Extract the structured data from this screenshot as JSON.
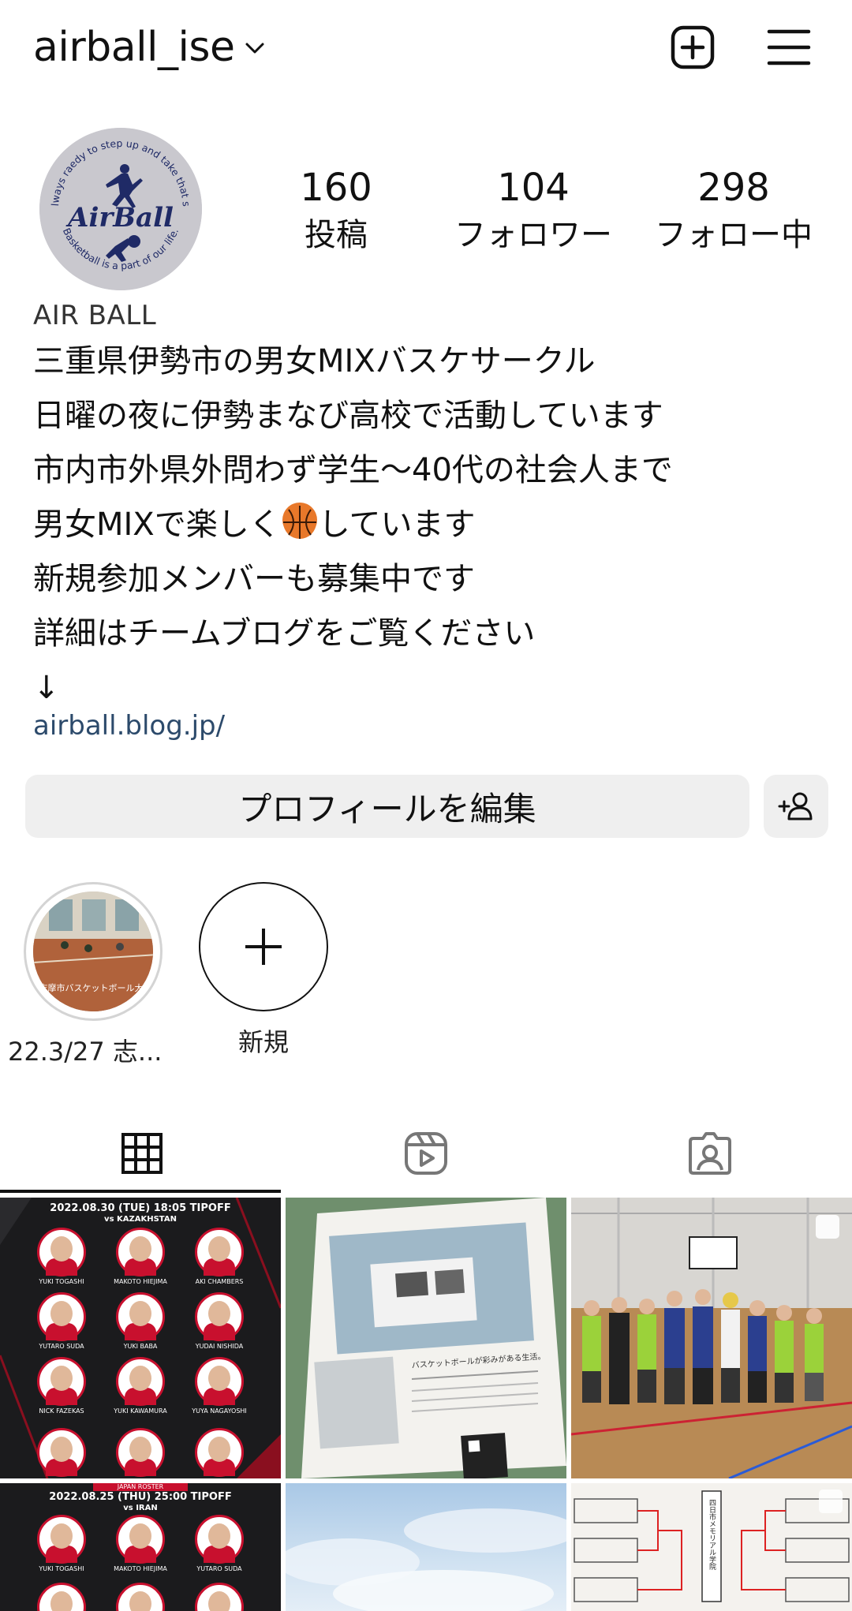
{
  "header": {
    "username": "airball_ise"
  },
  "profile": {
    "avatar_text_top": "I'm always raedy to step up and take that shot!!",
    "avatar_text_bottom": "Basketball is a part of our life.",
    "avatar_brand": "AirBall",
    "stats": {
      "posts_count": "160",
      "posts_label": "投稿",
      "followers_count": "104",
      "followers_label": "フォロワー",
      "following_count": "298",
      "following_label": "フォロー中"
    },
    "display_name": "AIR BALL",
    "bio_lines": [
      "三重県伊勢市の男女MIXバスケサークル",
      "日曜の夜に伊勢まなび高校で活動しています",
      "市内市外県外問わず学生〜40代の社会人まで",
      "男女MIXで楽しく",
      "新規参加メンバーも募集中です",
      "詳細はチームブログをご覧ください",
      "↓"
    ],
    "bio_line4_suffix": "しています",
    "link": "airball.blog.jp/"
  },
  "actions": {
    "edit_profile_label": "プロフィールを編集"
  },
  "highlights": [
    {
      "label": "22.3/27 志...",
      "caption": "志摩市バスケットボール大会"
    },
    {
      "label": "新規"
    }
  ],
  "tabs": [
    {
      "name": "grid",
      "active": true
    },
    {
      "name": "reels",
      "active": false
    },
    {
      "name": "tagged",
      "active": false
    }
  ],
  "posts": {
    "roster1": {
      "title": "2022.08.30 (TUE) 18:05 TIPOFF",
      "subtitle": "vs KAZAKHSTAN",
      "players": [
        "YUKI TOGASHI",
        "MAKOTO HIEJIMA",
        "AKI CHAMBERS",
        "YUTARO SUDA",
        "YUKI BABA",
        "YUDAI NISHIDA",
        "NICK FAZEKAS",
        "YUKI KAWAMURA",
        "YUYA NAGAYOSHI"
      ]
    },
    "roster2": {
      "banner": "JAPAN ROSTER",
      "title": "2022.08.25 (THU) 25:00 TIPOFF",
      "subtitle": "vs IRAN",
      "players": [
        "YUKI TOGASHI",
        "MAKOTO HIEJIMA",
        "YUTARO SUDA"
      ]
    },
    "flyer_text": "バスケットボールが彩みがある生活。",
    "bracket_title": "四日市メモリアル学院"
  },
  "colors": {
    "accent_ball": "#e8782a",
    "link": "#2c4a6b",
    "button_bg": "#efefef",
    "roster_red": "#c8102e"
  }
}
